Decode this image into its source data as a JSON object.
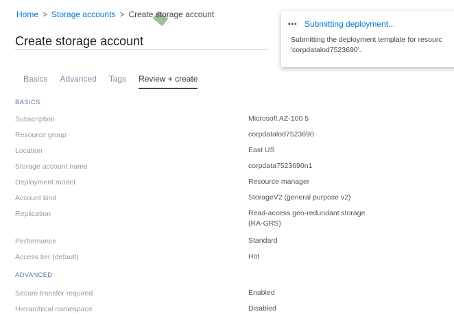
{
  "breadcrumb": {
    "home": "Home",
    "storage_accounts": "Storage accounts",
    "current": "Create storage account",
    "separator": ">"
  },
  "page": {
    "title": "Create storage account"
  },
  "toast": {
    "icon": "more-dots-icon",
    "title": "Submitting deployment...",
    "message": "Submitting the deployment template for resourc 'corpdatalod7523690'."
  },
  "tabs": [
    "Basics",
    "Advanced",
    "Tags",
    "Review + create"
  ],
  "basics": {
    "heading": "BASICS",
    "rows": [
      {
        "label": "Subscription",
        "value": "Microsoft AZ-100 5"
      },
      {
        "label": "Resource group",
        "value": "corpdatalod7523690"
      },
      {
        "label": "Location",
        "value": "East US"
      },
      {
        "label": "Storage account name",
        "value": "corpdata7523690n1"
      },
      {
        "label": "Deployment model",
        "value": "Resource manager"
      },
      {
        "label": "Account kind",
        "value": "StorageV2 (general purpose v2)"
      },
      {
        "label": "Replication",
        "value": "Read-access geo-redundant storage",
        "value2": "(RA-GRS)"
      },
      {
        "label": "Performance",
        "value": "Standard"
      },
      {
        "label": "Access tier (default)",
        "value": "Hot"
      }
    ]
  },
  "advanced": {
    "heading": "ADVANCED",
    "rows": [
      {
        "label": "Secure transfer required",
        "value": "Enabled"
      },
      {
        "label": "Hierarchical namespace",
        "value": "Disabled"
      }
    ]
  },
  "colors": {
    "accent": "#0078d4",
    "section": "#5b79a8"
  }
}
